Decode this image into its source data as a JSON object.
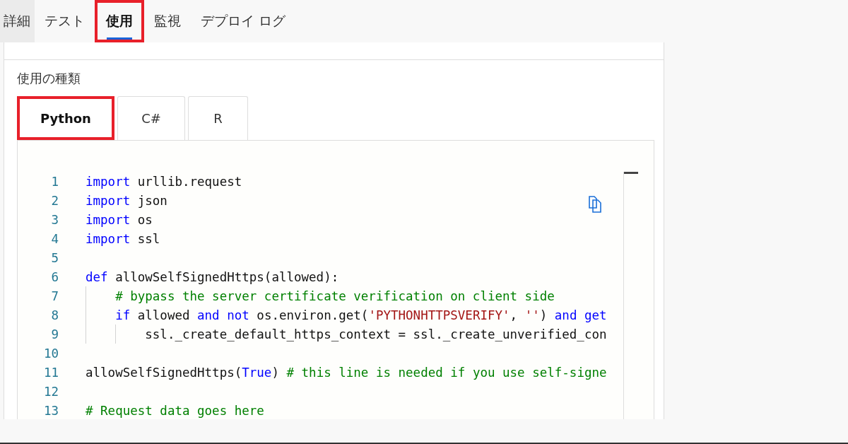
{
  "top_tabs": [
    {
      "label": "詳細",
      "selected": false,
      "hovered": true,
      "highlighted": false
    },
    {
      "label": "テスト",
      "selected": false,
      "hovered": false,
      "highlighted": false
    },
    {
      "label": "使用",
      "selected": true,
      "hovered": false,
      "highlighted": true
    },
    {
      "label": "監視",
      "selected": false,
      "hovered": false,
      "highlighted": false
    },
    {
      "label": "デプロイ ログ",
      "selected": false,
      "hovered": false,
      "highlighted": false
    }
  ],
  "usage_label": "使用の種類",
  "language_tabs": [
    {
      "label": "Python",
      "selected": true,
      "highlighted": true
    },
    {
      "label": "C#",
      "selected": false,
      "highlighted": false
    },
    {
      "label": "R",
      "selected": false,
      "highlighted": false
    }
  ],
  "code": {
    "lines": [
      {
        "number": "1",
        "tokens": [
          {
            "kind": "keyword",
            "text": "import"
          },
          {
            "kind": "plain",
            "text": " urllib.request"
          }
        ]
      },
      {
        "number": "2",
        "tokens": [
          {
            "kind": "keyword",
            "text": "import"
          },
          {
            "kind": "plain",
            "text": " json"
          }
        ]
      },
      {
        "number": "3",
        "tokens": [
          {
            "kind": "keyword",
            "text": "import"
          },
          {
            "kind": "plain",
            "text": " os"
          }
        ]
      },
      {
        "number": "4",
        "tokens": [
          {
            "kind": "keyword",
            "text": "import"
          },
          {
            "kind": "plain",
            "text": " ssl"
          }
        ]
      },
      {
        "number": "5"
      },
      {
        "number": "6",
        "tokens": [
          {
            "kind": "keyword",
            "text": "def"
          },
          {
            "kind": "plain",
            "text": " allowSelfSignedHttps(allowed):"
          }
        ],
        "children": [
          {
            "number": "7",
            "tokens": [
              {
                "kind": "comment",
                "text": "# bypass the server certificate verification on client side"
              }
            ]
          },
          {
            "number": "8",
            "tokens": [
              {
                "kind": "keyword",
                "text": "if"
              },
              {
                "kind": "plain",
                "text": " allowed "
              },
              {
                "kind": "keyword",
                "text": "and"
              },
              {
                "kind": "keyword",
                "text": " not"
              },
              {
                "kind": "plain",
                "text": " os.environ.get("
              },
              {
                "kind": "string",
                "text": "'PYTHONHTTPSVERIFY'"
              },
              {
                "kind": "plain",
                "text": ", "
              },
              {
                "kind": "string",
                "text": "''"
              },
              {
                "kind": "plain",
                "text": ") "
              },
              {
                "kind": "keyword",
                "text": "and"
              },
              {
                "kind": "keyword",
                "text": " get"
              }
            ],
            "children": [
              {
                "number": "9",
                "tokens": [
                  {
                    "kind": "plain",
                    "text": "ssl._create_default_https_context = ssl._create_unverified_con"
                  }
                ]
              }
            ]
          }
        ]
      },
      {
        "number": "10"
      },
      {
        "number": "11",
        "tokens": [
          {
            "kind": "plain",
            "text": "allowSelfSignedHttps("
          },
          {
            "kind": "keyword",
            "text": "True"
          },
          {
            "kind": "plain",
            "text": ") "
          },
          {
            "kind": "comment",
            "text": "# this line is needed if you use self-signe"
          }
        ]
      },
      {
        "number": "12"
      },
      {
        "number": "13",
        "tokens": [
          {
            "kind": "comment",
            "text": "# Request data goes here"
          }
        ]
      }
    ]
  }
}
